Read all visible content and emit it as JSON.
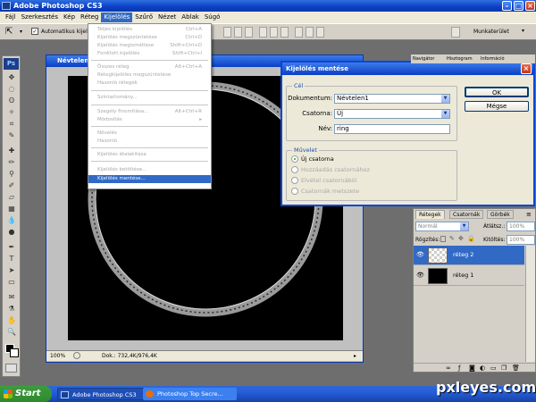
{
  "titlebar": {
    "title": "Adobe Photoshop CS3"
  },
  "menubar": {
    "items": [
      "Fájl",
      "Szerkesztés",
      "Kép",
      "Réteg",
      "Kijelölés",
      "Szűrő",
      "Nézet",
      "Ablak",
      "Súgó"
    ],
    "active_index": 4
  },
  "options_bar": {
    "auto_select_label": "Automatikus kijelölés",
    "workspace_label": "Munkaterület"
  },
  "toolbox": {
    "logo": "Ps"
  },
  "document": {
    "title": "Névtelen1",
    "zoom": "100%",
    "status": "Dok.: 732,4K/976,4K"
  },
  "dropdown": {
    "items": [
      {
        "label": "Teljes kijelölés",
        "shortcut": "Ctrl+A"
      },
      {
        "label": "Kijelölés megszüntetése",
        "shortcut": "Ctrl+D"
      },
      {
        "label": "Kijelölés megismétlése",
        "shortcut": "Shift+Ctrl+D"
      },
      {
        "label": "Fordított kijelölés",
        "shortcut": "Shift+Ctrl+I"
      },
      {
        "label": "Összes réteg",
        "shortcut": "Alt+Ctrl+A"
      },
      {
        "label": "Rétegkijelölés megszüntetése",
        "shortcut": ""
      },
      {
        "label": "Hasonló rétegek",
        "shortcut": ""
      },
      {
        "label": "Színtartomány...",
        "shortcut": ""
      },
      {
        "label": "Szegély finomítása...",
        "shortcut": "Alt+Ctrl+R"
      },
      {
        "label": "Módosítás",
        "shortcut": "▸"
      },
      {
        "label": "Növelés",
        "shortcut": ""
      },
      {
        "label": "Hasonló",
        "shortcut": ""
      },
      {
        "label": "Kijelölés átalakítása",
        "shortcut": ""
      },
      {
        "label": "Kijelölés betöltése...",
        "shortcut": ""
      },
      {
        "label": "Kijelölés mentése...",
        "shortcut": ""
      }
    ]
  },
  "dialog": {
    "title": "Kijelölés mentése",
    "cel_group": "Cél",
    "dokumentum_label": "Dokumentum:",
    "dokumentum_value": "Névtelen1",
    "csatorna_label": "Csatorna:",
    "csatorna_value": "Új",
    "nev_label": "Név:",
    "nev_value": "ring",
    "muvelet_group": "Művelet",
    "radios": [
      "Új csatorna",
      "Hozzáadás csatornához",
      "Elvétel csatornából",
      "Csatornák metszete"
    ],
    "ok_label": "OK",
    "cancel_label": "Mégse"
  },
  "top_panels": {
    "tabs": [
      "Navigátor",
      "Hisztogram",
      "Információ"
    ]
  },
  "layers_panel": {
    "tabs": [
      "Rétegek",
      "Csatornák",
      "Görbék"
    ],
    "blend_mode": "Normál",
    "opacity_label": "Átlátsz.:",
    "opacity_value": "100%",
    "lock_label": "Rögzítés:",
    "fill_label": "Kitöltés:",
    "fill_value": "100%",
    "layers": [
      {
        "name": "réteg 2",
        "selected": true
      },
      {
        "name": "réteg 1",
        "selected": false
      }
    ]
  },
  "taskbar": {
    "start_label": "Start",
    "tasks": [
      "Adobe Photoshop CS3",
      "Photoshop Top Secre..."
    ]
  },
  "watermark": "pxleyes.com",
  "colors": {
    "accent": "#316ac5",
    "xp_blue": "#245edb",
    "start_green": "#3c9c3c"
  }
}
